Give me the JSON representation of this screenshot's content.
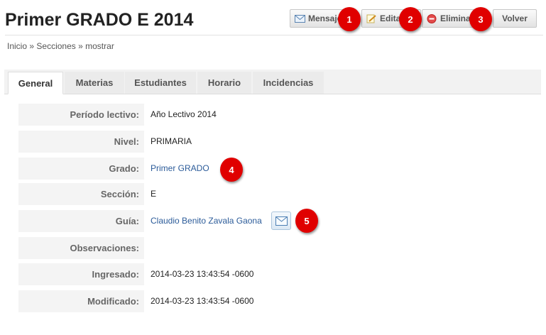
{
  "page": {
    "title": "Primer GRADO E 2014"
  },
  "actions": {
    "message_label": "Mensaje",
    "edit_label": "Editar",
    "delete_label": "Eliminar",
    "back_label": "Volver"
  },
  "breadcrumb": [
    "Inicio",
    "Secciones",
    "mostrar"
  ],
  "breadcrumb_separator": "»",
  "tabs": [
    "General",
    "Materias",
    "Estudiantes",
    "Horario",
    "Incidencias"
  ],
  "fields": [
    {
      "label": "Período lectivo:",
      "value": "Año Lectivo 2014"
    },
    {
      "label": "Nivel:",
      "value": "PRIMARIA"
    },
    {
      "label": "Grado:",
      "value": "Primer GRADO"
    },
    {
      "label": "Sección:",
      "value": "E"
    },
    {
      "label": "Guía:",
      "value": "Claudio Benito Zavala Gaona"
    },
    {
      "label": "Observaciones:",
      "value": ""
    },
    {
      "label": "Ingresado:",
      "value": "2014-03-23 13:43:54 -0600"
    },
    {
      "label": "Modificado:",
      "value": "2014-03-23 13:43:54 -0600"
    }
  ],
  "callouts": [
    "1",
    "2",
    "3",
    "4",
    "5"
  ],
  "colors": {
    "link": "#2b5b99",
    "callout": "#e00000",
    "label_bg": "#f4f4f4"
  },
  "icons": {
    "message": "envelope-icon",
    "edit": "pencil-icon",
    "delete": "delete-icon",
    "guide_mail": "envelope-icon"
  }
}
